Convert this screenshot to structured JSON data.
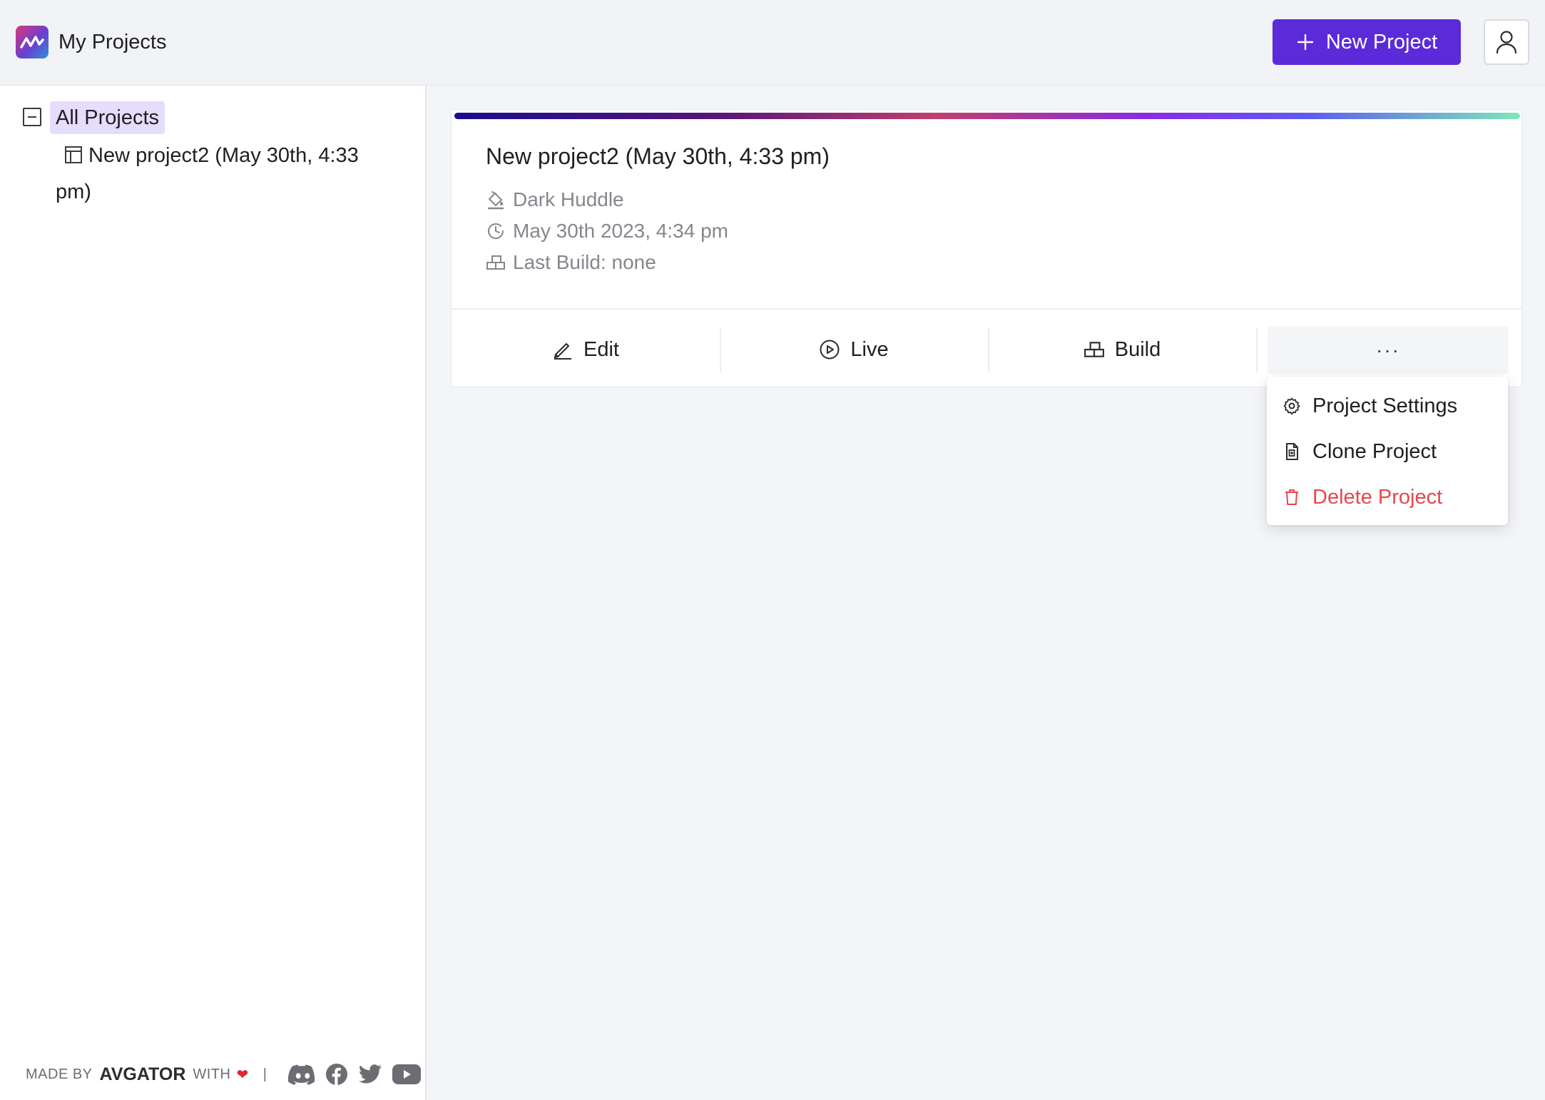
{
  "header": {
    "app_title": "My Projects",
    "new_project_label": "New Project",
    "accent_color": "#5b2bd9"
  },
  "sidebar": {
    "root_label": "All Projects",
    "children": [
      {
        "label": "New project2 (May 30th, 4:33 pm)"
      }
    ]
  },
  "footer": {
    "made_by": "MADE BY",
    "brand": "AVGATOR",
    "with": "WITH",
    "separator": "|",
    "social_icons": [
      "discord-icon",
      "facebook-icon",
      "twitter-icon",
      "youtube-icon"
    ]
  },
  "project_card": {
    "title": "New project2 (May 30th, 4:33 pm)",
    "theme": "Dark Huddle",
    "date": "May 30th 2023, 4:34 pm",
    "last_build": "Last Build: none",
    "actions": {
      "edit": "Edit",
      "live": "Live",
      "build": "Build",
      "more": "···"
    }
  },
  "dropdown": {
    "items": [
      {
        "label": "Project Settings",
        "icon": "gear-icon"
      },
      {
        "label": "Clone Project",
        "icon": "clone-icon"
      },
      {
        "label": "Delete Project",
        "icon": "trash-icon",
        "color": "#e5484d"
      }
    ]
  }
}
